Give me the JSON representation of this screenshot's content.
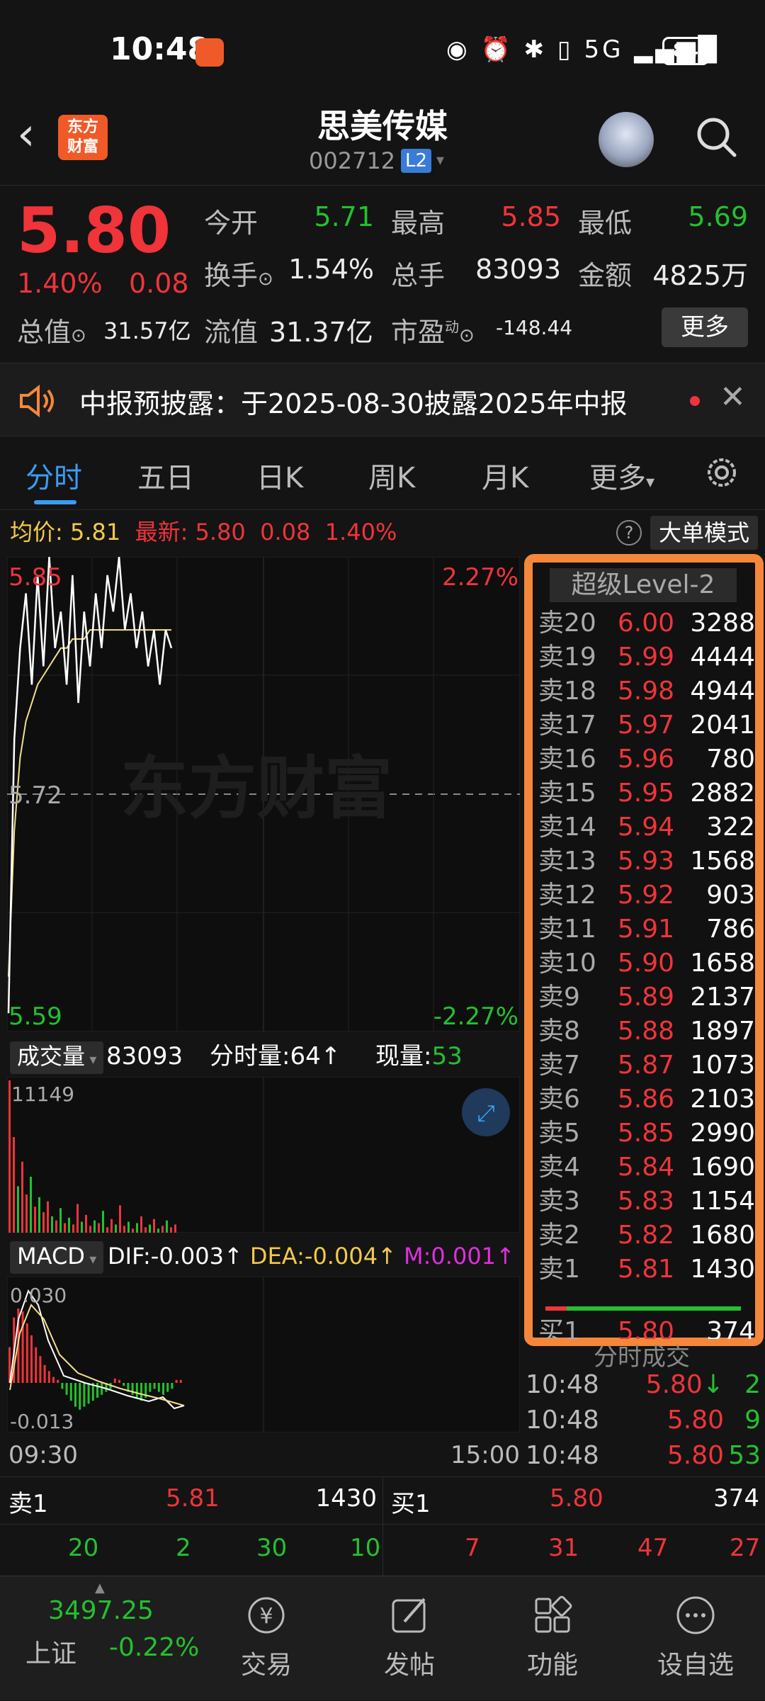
{
  "status": {
    "time": "10:48",
    "battery": "84",
    "signal": "5G"
  },
  "header": {
    "stock_name": "思美传媒",
    "stock_code": "002712",
    "level_badge": "L2",
    "logo_text_line1": "东方",
    "logo_text_line2": "财富"
  },
  "quote": {
    "price": "5.80",
    "change_pct": "1.40%",
    "change": "0.08",
    "open_label": "今开",
    "open": "5.71",
    "high_label": "最高",
    "high": "5.85",
    "low_label": "最低",
    "low": "5.69",
    "turnover_label": "换手",
    "turnover": "1.54%",
    "volume_label": "总手",
    "volume": "83093",
    "amount_label": "金额",
    "amount": "4825万",
    "mktcap_label": "总值",
    "mktcap": "31.57亿",
    "float_label": "流值",
    "float_cap": "31.37亿",
    "pe_label": "市盈",
    "pe_sup": "动",
    "pe": "-148.44",
    "more": "更多"
  },
  "notice": {
    "text": "中报预披露：于2025-08-30披露2025年中报"
  },
  "tabs": [
    "分时",
    "五日",
    "日K",
    "周K",
    "月K",
    "更多"
  ],
  "info": {
    "avg_label": "均价:",
    "avg": "5.81",
    "latest_label": "最新:",
    "latest": "5.80",
    "change": "0.08",
    "change_pct": "1.40%",
    "help": "?",
    "big_order": "大单模式"
  },
  "chart": {
    "top_price": "5.85",
    "top_pct": "2.27%",
    "mid_price": "5.72",
    "bottom_price": "5.59",
    "bottom_pct": "-2.27%",
    "watermark": "东方财富",
    "vol_label": "成交量",
    "vol_total": "83093",
    "minute_vol_label": "分时量:",
    "minute_vol": "64",
    "cur_vol_label": "现量:",
    "cur_vol": "53",
    "vol_max": "11149",
    "macd_label": "MACD",
    "dif": "DIF:-0.003",
    "dea": "DEA:-0.004",
    "m": "M:0.001",
    "macd_top": "0.030",
    "macd_bottom": "-0.013",
    "time_start": "09:30",
    "time_end": "15:00",
    "colors": {
      "up": "#f0343a",
      "down": "#24c02f",
      "price_line": "#ffffff",
      "avg_line": "#f2e08a"
    }
  },
  "chart_data": {
    "type": "line",
    "ylim": [
      5.59,
      5.85
    ],
    "series": [
      {
        "name": "价格",
        "values": [
          5.6,
          5.75,
          5.8,
          5.83,
          5.78,
          5.84,
          5.79,
          5.85,
          5.8,
          5.82,
          5.78,
          5.84,
          5.77,
          5.82,
          5.79,
          5.83,
          5.8,
          5.84,
          5.82,
          5.85,
          5.81,
          5.83,
          5.8,
          5.82,
          5.79,
          5.81,
          5.78,
          5.81,
          5.8
        ]
      },
      {
        "name": "均价",
        "values": [
          5.62,
          5.7,
          5.74,
          5.76,
          5.77,
          5.78,
          5.785,
          5.79,
          5.795,
          5.8,
          5.8,
          5.805,
          5.805,
          5.805,
          5.81,
          5.81,
          5.81,
          5.81,
          5.81,
          5.81,
          5.81,
          5.81,
          5.81,
          5.81,
          5.81,
          5.81,
          5.81,
          5.81,
          5.81
        ]
      }
    ]
  },
  "volume_data": [
    11149,
    7000,
    3400,
    5200,
    2800,
    4100,
    1900,
    2600,
    1500,
    2300,
    1200,
    900,
    1800,
    700,
    1100,
    600,
    2100,
    800,
    1300,
    500,
    900,
    700,
    1600,
    400,
    1000,
    600,
    2000,
    500,
    800,
    300,
    700,
    1200,
    400,
    600,
    1000,
    300,
    500,
    900,
    400,
    600
  ],
  "volume_up": [
    1,
    1,
    0,
    1,
    1,
    0,
    1,
    0,
    1,
    1,
    0,
    1,
    0,
    1,
    0,
    1,
    1,
    0,
    1,
    1,
    0,
    1,
    0,
    1,
    1,
    0,
    1,
    1,
    0,
    1,
    0,
    1,
    1,
    0,
    1,
    0,
    1,
    0,
    1,
    1
  ],
  "macd_data": [
    0.012,
    0.022,
    0.025,
    0.024,
    0.02,
    0.016,
    0.012,
    0.009,
    0.006,
    0.004,
    0.002,
    0.001,
    -0.002,
    -0.004,
    -0.006,
    -0.008,
    -0.009,
    -0.008,
    -0.007,
    -0.006,
    -0.005,
    -0.004,
    -0.003,
    -0.002,
    0.0015,
    0.001,
    -0.001,
    -0.003,
    -0.004,
    -0.005,
    -0.006,
    -0.005,
    -0.003,
    -0.002,
    -0.003,
    -0.004,
    -0.003,
    -0.002,
    0.001,
    0.001
  ],
  "order_book": {
    "title": "超级Level-2",
    "asks": [
      {
        "label": "卖20",
        "price": "6.00",
        "vol": "3288"
      },
      {
        "label": "卖19",
        "price": "5.99",
        "vol": "4444"
      },
      {
        "label": "卖18",
        "price": "5.98",
        "vol": "4944"
      },
      {
        "label": "卖17",
        "price": "5.97",
        "vol": "2041"
      },
      {
        "label": "卖16",
        "price": "5.96",
        "vol": "780"
      },
      {
        "label": "卖15",
        "price": "5.95",
        "vol": "2882"
      },
      {
        "label": "卖14",
        "price": "5.94",
        "vol": "322"
      },
      {
        "label": "卖13",
        "price": "5.93",
        "vol": "1568"
      },
      {
        "label": "卖12",
        "price": "5.92",
        "vol": "903"
      },
      {
        "label": "卖11",
        "price": "5.91",
        "vol": "786"
      },
      {
        "label": "卖10",
        "price": "5.90",
        "vol": "1658"
      },
      {
        "label": "卖9",
        "price": "5.89",
        "vol": "2137"
      },
      {
        "label": "卖8",
        "price": "5.88",
        "vol": "1897"
      },
      {
        "label": "卖7",
        "price": "5.87",
        "vol": "1073"
      },
      {
        "label": "卖6",
        "price": "5.86",
        "vol": "2103"
      },
      {
        "label": "卖5",
        "price": "5.85",
        "vol": "2990"
      },
      {
        "label": "卖4",
        "price": "5.84",
        "vol": "1690"
      },
      {
        "label": "卖3",
        "price": "5.83",
        "vol": "1154"
      },
      {
        "label": "卖2",
        "price": "5.82",
        "vol": "1680"
      },
      {
        "label": "卖1",
        "price": "5.81",
        "vol": "1430"
      }
    ],
    "bid1": {
      "label": "买1",
      "price": "5.80",
      "vol": "374"
    }
  },
  "trades": {
    "title": "分时成交",
    "rows": [
      {
        "time": "10:48",
        "price": "5.80",
        "arrow": "↓",
        "vol": "2"
      },
      {
        "time": "10:48",
        "price": "5.80",
        "arrow": "",
        "vol": "9"
      },
      {
        "time": "10:48",
        "price": "5.80",
        "arrow": "",
        "vol": "53"
      }
    ]
  },
  "depth": {
    "sell1_label": "卖1",
    "sell1_price": "5.81",
    "sell1_vol": "1430",
    "buy1_label": "买1",
    "buy1_price": "5.80",
    "buy1_vol": "374",
    "sell_queue": [
      "20",
      "2",
      "30",
      "10"
    ],
    "buy_queue": [
      "7",
      "31",
      "47",
      "27"
    ]
  },
  "nav": {
    "index_value": "3497.25",
    "index_name": "上证",
    "index_change": "-0.22%",
    "items": [
      "交易",
      "发帖",
      "功能",
      "设自选"
    ]
  }
}
